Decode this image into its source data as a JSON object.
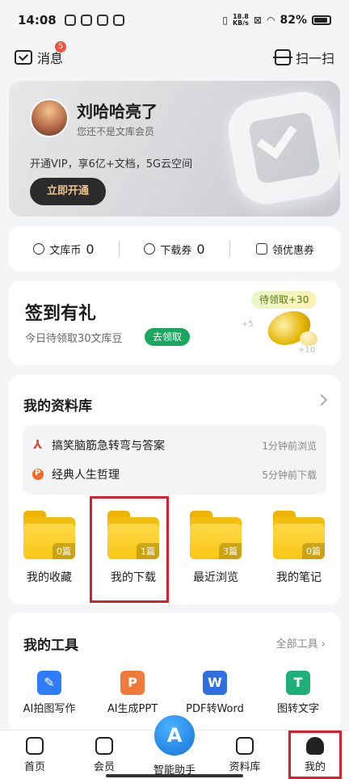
{
  "status": {
    "time": "14:08",
    "net_speed_top": "18.8",
    "net_speed_bottom": "KB/s",
    "battery": "82%"
  },
  "topbar": {
    "messages_label": "消息",
    "messages_badge": "5",
    "scan_label": "扫一扫"
  },
  "vip": {
    "username": "刘哈哈亮了",
    "member_status": "您还不是文库会员",
    "promo": "开通VIP，享6亿+文档，5G云空间",
    "open_button": "立即开通"
  },
  "coupons": {
    "coin_label": "文库币",
    "coin_value": "0",
    "download_label": "下载券",
    "download_value": "0",
    "claim_label": "领优惠券"
  },
  "signin": {
    "title": "签到有礼",
    "subtitle": "今日待领取30文库豆",
    "button": "去领取",
    "bubble": "待领取+30",
    "plus5": "+5",
    "plus10": "+10"
  },
  "library": {
    "title": "我的资料库",
    "recent": [
      {
        "name": "搞笑脑筋急转弯与答案",
        "time": "1分钟前浏览",
        "type": "pdf"
      },
      {
        "name": "经典人生哲理",
        "time": "5分钟前下载",
        "type": "ppt"
      }
    ],
    "folders": [
      {
        "label": "我的收藏",
        "count": "0篇"
      },
      {
        "label": "我的下载",
        "count": "1篇"
      },
      {
        "label": "最近浏览",
        "count": "3篇"
      },
      {
        "label": "我的笔记",
        "count": "0篇"
      }
    ]
  },
  "tools": {
    "title": "我的工具",
    "all_label": "全部工具",
    "items": [
      {
        "label": "AI拍图写作",
        "glyph": "✎",
        "color": "#2f7df6"
      },
      {
        "label": "AI生成PPT",
        "glyph": "P",
        "color": "#f07a3a"
      },
      {
        "label": "PDF转Word",
        "glyph": "W",
        "color": "#2f6fe0"
      },
      {
        "label": "图转文字",
        "glyph": "T",
        "color": "#1fb07a"
      }
    ]
  },
  "tabbar": {
    "home": "首页",
    "member": "会员",
    "assistant": "智能助手",
    "library": "资料库",
    "me": "我的"
  }
}
